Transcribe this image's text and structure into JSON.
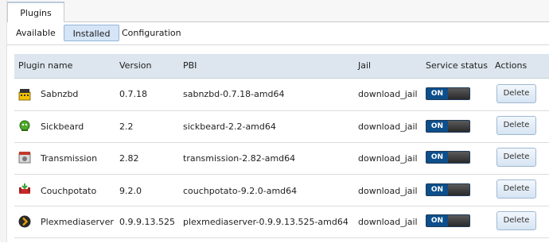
{
  "main_tab": "Plugins",
  "subtabs": [
    {
      "label": "Available",
      "active": false
    },
    {
      "label": "Installed",
      "active": true
    },
    {
      "label": "Configuration",
      "active": false
    }
  ],
  "table": {
    "columns": [
      "Plugin name",
      "Version",
      "PBI",
      "Jail",
      "Service status",
      "Actions"
    ],
    "rows": [
      {
        "icon": "sabnzbd-icon",
        "name": "Sabnzbd",
        "version": "0.7.18",
        "pbi": "sabnzbd-0.7.18-amd64",
        "jail": "download_jail",
        "status": "ON",
        "action": "Delete"
      },
      {
        "icon": "sickbeard-icon",
        "name": "Sickbeard",
        "version": "2.2",
        "pbi": "sickbeard-2.2-amd64",
        "jail": "download_jail",
        "status": "ON",
        "action": "Delete"
      },
      {
        "icon": "transmission-icon",
        "name": "Transmission",
        "version": "2.82",
        "pbi": "transmission-2.82-amd64",
        "jail": "download_jail",
        "status": "ON",
        "action": "Delete"
      },
      {
        "icon": "couchpotato-icon",
        "name": "Couchpotato",
        "version": "9.2.0",
        "pbi": "couchpotato-9.2.0-amd64",
        "jail": "download_jail",
        "status": "ON",
        "action": "Delete"
      },
      {
        "icon": "plexmediaserver-icon",
        "name": "Plexmediaserver",
        "version": "0.9.9.13.525",
        "pbi": "plexmediaserver-0.9.9.13.525-amd64",
        "jail": "download_jail",
        "status": "ON",
        "action": "Delete"
      }
    ]
  },
  "colors": {
    "header_bg": "#dde6ee",
    "active_subtab": "#d5e5f7",
    "toggle_on": "#0d4f8b"
  }
}
